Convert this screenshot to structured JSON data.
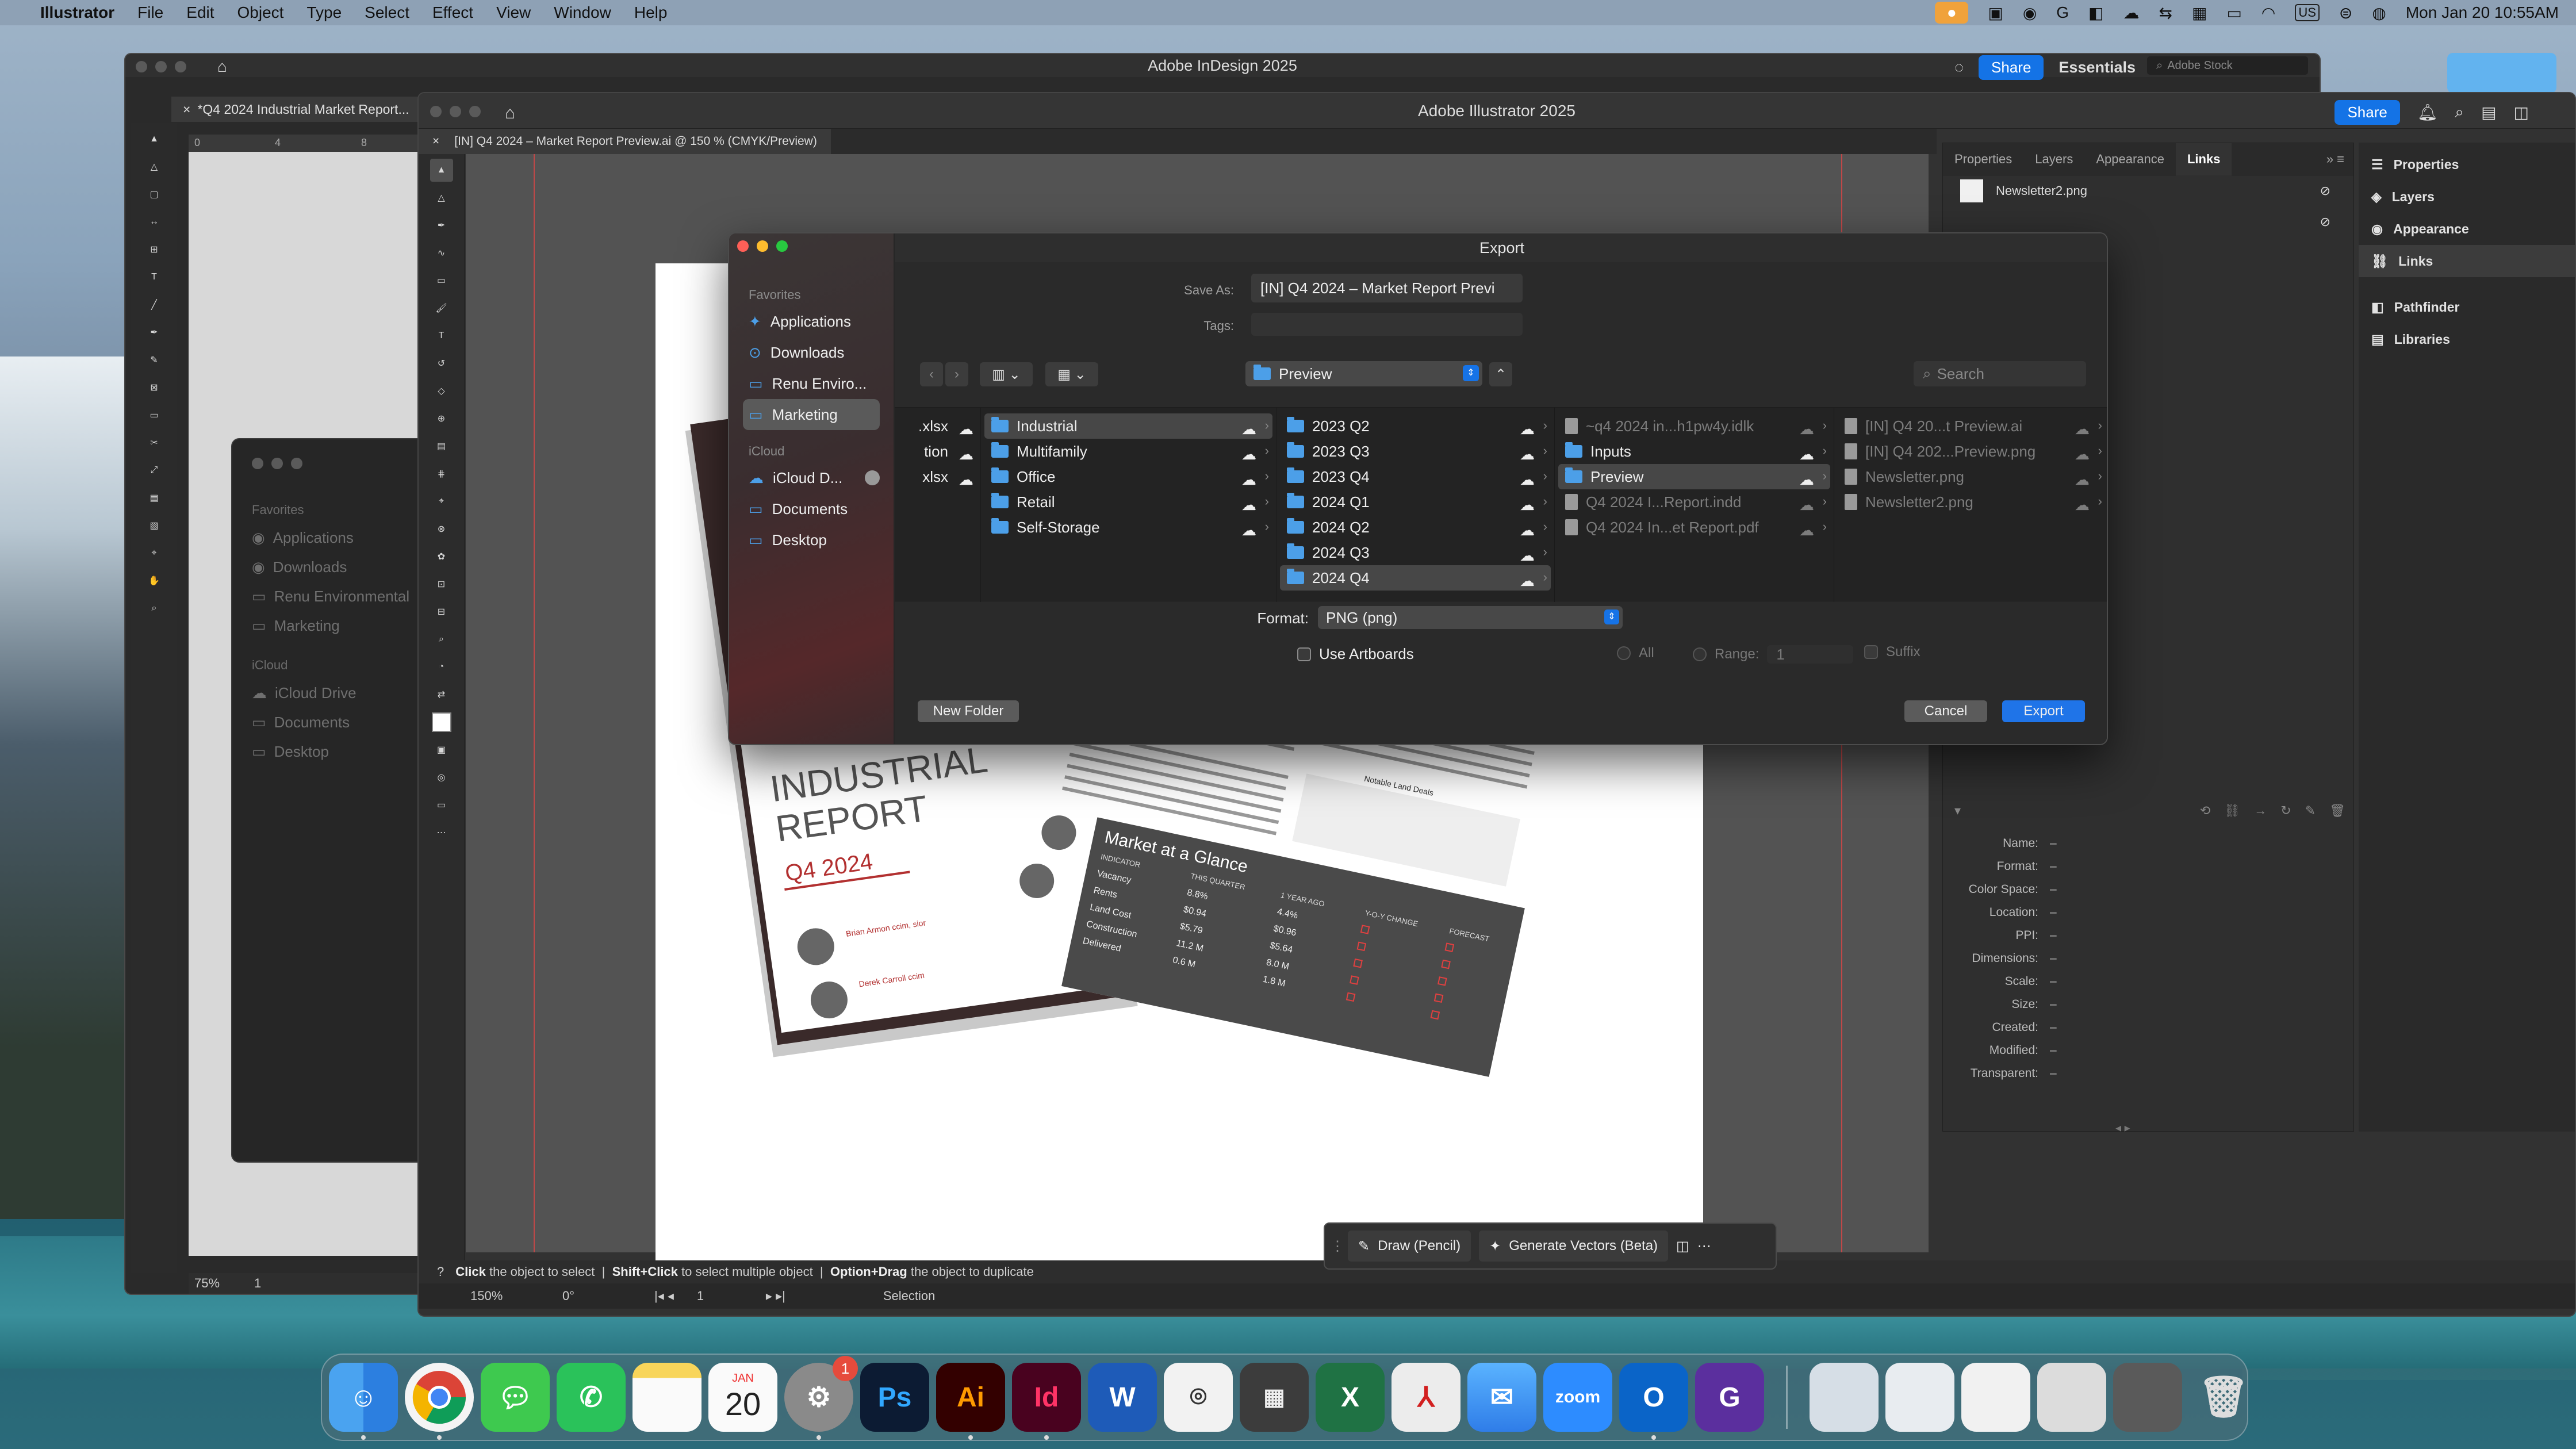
{
  "menubar": {
    "app": "Illustrator",
    "items": [
      "File",
      "Edit",
      "Object",
      "Type",
      "Select",
      "Effect",
      "View",
      "Window",
      "Help"
    ],
    "keyboard": "US",
    "datetime": "Mon Jan 20  10:55AM"
  },
  "indesign": {
    "title": "Adobe InDesign 2025",
    "tab": "*Q4 2024 Industrial Market Report...",
    "zoom": "75%",
    "page": "1",
    "share": "Share",
    "workspace": "Essentials",
    "search_placeholder": "Adobe Stock",
    "ruler_marks": [
      "0",
      "4",
      "8"
    ]
  },
  "ghost_finder": {
    "favorites_header": "Favorites",
    "favorites": [
      "Applications",
      "Downloads",
      "Renu Environmental",
      "Marketing"
    ],
    "icloud_header": "iCloud",
    "icloud": [
      "iCloud Drive",
      "Documents",
      "Desktop"
    ]
  },
  "illustrator": {
    "title": "Adobe Illustrator 2025",
    "share": "Share",
    "tab": "[IN] Q4 2024 – Market Report Preview.ai @ 150 % (CMYK/Preview)",
    "status": {
      "click": "Click",
      "click_text": "the object to select",
      "shift": "Shift+Click",
      "shift_text": "to select multiple object",
      "opt": "Option+Drag",
      "opt_text": "the object to duplicate"
    },
    "bottom": {
      "zoom": "150%",
      "rotate": "0°",
      "artboard": "1",
      "mode": "Selection"
    },
    "floatbar": {
      "draw": "Draw (Pencil)",
      "vectors": "Generate Vectors (Beta)"
    }
  },
  "links_panel": {
    "tabs": [
      "Properties",
      "Layers",
      "Appearance",
      "Links"
    ],
    "active_tab": "Links",
    "items": [
      "Newsletter2.png",
      ""
    ],
    "meta_keys": [
      "Name:",
      "Format:",
      "Color Space:",
      "Location:",
      "PPI:",
      "Dimensions:",
      "Scale:",
      "Size:",
      "Created:",
      "Modified:",
      "Transparent:"
    ],
    "meta_value": "–"
  },
  "right_dock": {
    "items": [
      "Properties",
      "Layers",
      "Appearance",
      "Links"
    ],
    "items2": [
      "Pathfinder",
      "Libraries"
    ],
    "selected": "Links"
  },
  "export_dialog": {
    "title": "Export",
    "save_as_label": "Save As:",
    "save_as_value": "[IN] Q4 2024 – Market Report Previ",
    "tags_label": "Tags:",
    "location": "Preview",
    "search_placeholder": "Search",
    "sidebar": {
      "favorites_header": "Favorites",
      "favorites": [
        "Applications",
        "Downloads",
        "Renu Enviro...",
        "Marketing"
      ],
      "selected": "Marketing",
      "icloud_header": "iCloud",
      "icloud": [
        "iCloud D...",
        "Documents",
        "Desktop"
      ]
    },
    "col0": [
      ".xlsx",
      "tion",
      "xlsx"
    ],
    "col1": [
      "Industrial",
      "Multifamily",
      "Office",
      "Retail",
      "Self-Storage"
    ],
    "col1_selected": "Industrial",
    "col2": [
      "2023 Q2",
      "2023 Q3",
      "2023 Q4",
      "2024 Q1",
      "2024 Q2",
      "2024 Q3",
      "2024 Q4"
    ],
    "col2_selected": "2024 Q4",
    "col3": [
      "~q4 2024 in...h1pw4y.idlk",
      "Inputs",
      "Preview",
      "Q4 2024 I...Report.indd",
      "Q4 2024 In...et Report.pdf"
    ],
    "col3_selected": "Preview",
    "col4": [
      "[IN] Q4 20...t Preview.ai",
      "[IN] Q4 202...Preview.png",
      "Newsletter.png",
      "Newsletter2.png"
    ],
    "format_label": "Format:",
    "format_value": "PNG (png)",
    "use_artboards": "Use Artboards",
    "all": "All",
    "range": "Range:",
    "range_value": "1",
    "suffix": "Suffix",
    "new_folder": "New Folder",
    "cancel": "Cancel",
    "export": "Export"
  },
  "brochure": {
    "title1": "INDUSTRIAL",
    "title2": "REPORT",
    "subtitle": "Q4 2024",
    "glance_title": "Market at a Glance",
    "glance_header": [
      "INDICATOR",
      "THIS QUARTER",
      "1 YEAR AGO",
      "Y-O-Y CHANGE",
      "FORECAST"
    ],
    "glance_rows": [
      [
        "Vacancy",
        "8.8%",
        "4.4%"
      ],
      [
        "Rents",
        "$0.94",
        "$0.96"
      ],
      [
        "Land Cost",
        "$5.79",
        "$5.64"
      ],
      [
        "Construction",
        "11.2 M",
        "8.0 M"
      ],
      [
        "Delivered",
        "0.6 M",
        "1.8 M"
      ]
    ],
    "contact1": "Brian Armon ccim, sior",
    "contact2": "Derek Carroll ccim",
    "land_deals": "Notable Land Deals"
  },
  "dock": {
    "calendar_month": "JAN",
    "calendar_day": "20",
    "settings_badge": "1",
    "labels": [
      "Finder",
      "Chrome",
      "Messages",
      "WhatsApp",
      "Notes",
      "Calendar",
      "System Settings",
      "Photoshop",
      "Illustrator",
      "InDesign",
      "Word",
      "Screenshot",
      "Calculator",
      "Excel",
      "Acrobat",
      "Mail",
      "Zoom",
      "Outlook",
      "Gimp"
    ]
  }
}
